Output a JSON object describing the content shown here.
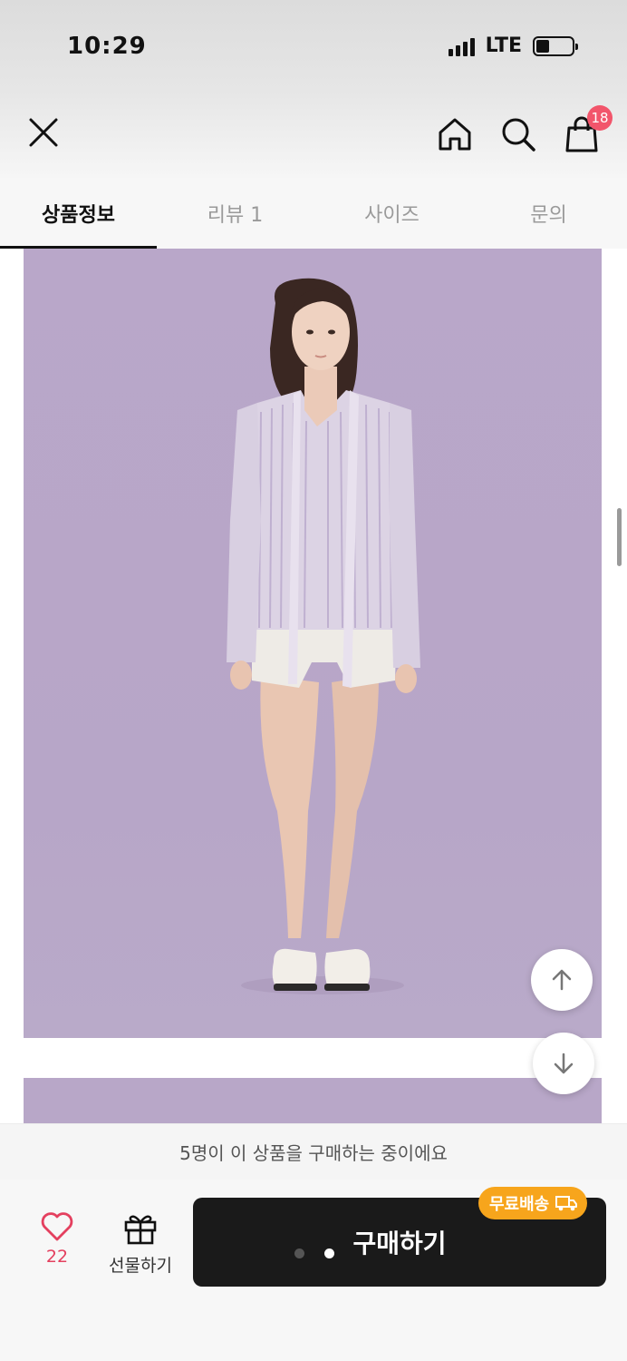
{
  "status_bar": {
    "time": "10:29",
    "network": "LTE"
  },
  "header": {
    "cart_count": "18"
  },
  "tabs": [
    {
      "label": "상품정보",
      "active": true
    },
    {
      "label": "리뷰 1",
      "active": false
    },
    {
      "label": "사이즈",
      "active": false
    },
    {
      "label": "문의",
      "active": false
    }
  ],
  "banner": {
    "text": "5명이 이 상품을 구매하는 중이에요"
  },
  "bottom_bar": {
    "like_count": "22",
    "gift_label": "선물하기",
    "buy_label": "구매하기",
    "free_shipping_label": "무료배송"
  },
  "colors": {
    "accent": "#e4405f",
    "badge": "#f2556b",
    "free_shipping": "#f7a51c",
    "buy_button": "#1a1a1a",
    "product_background": "#b9a7c9"
  },
  "icons": {
    "close": "close-icon",
    "home": "home-icon",
    "search": "search-icon",
    "cart": "cart-icon",
    "scroll_up": "arrow-up-icon",
    "scroll_down": "arrow-down-icon",
    "like": "heart-icon",
    "gift": "gift-icon",
    "truck": "truck-icon"
  }
}
